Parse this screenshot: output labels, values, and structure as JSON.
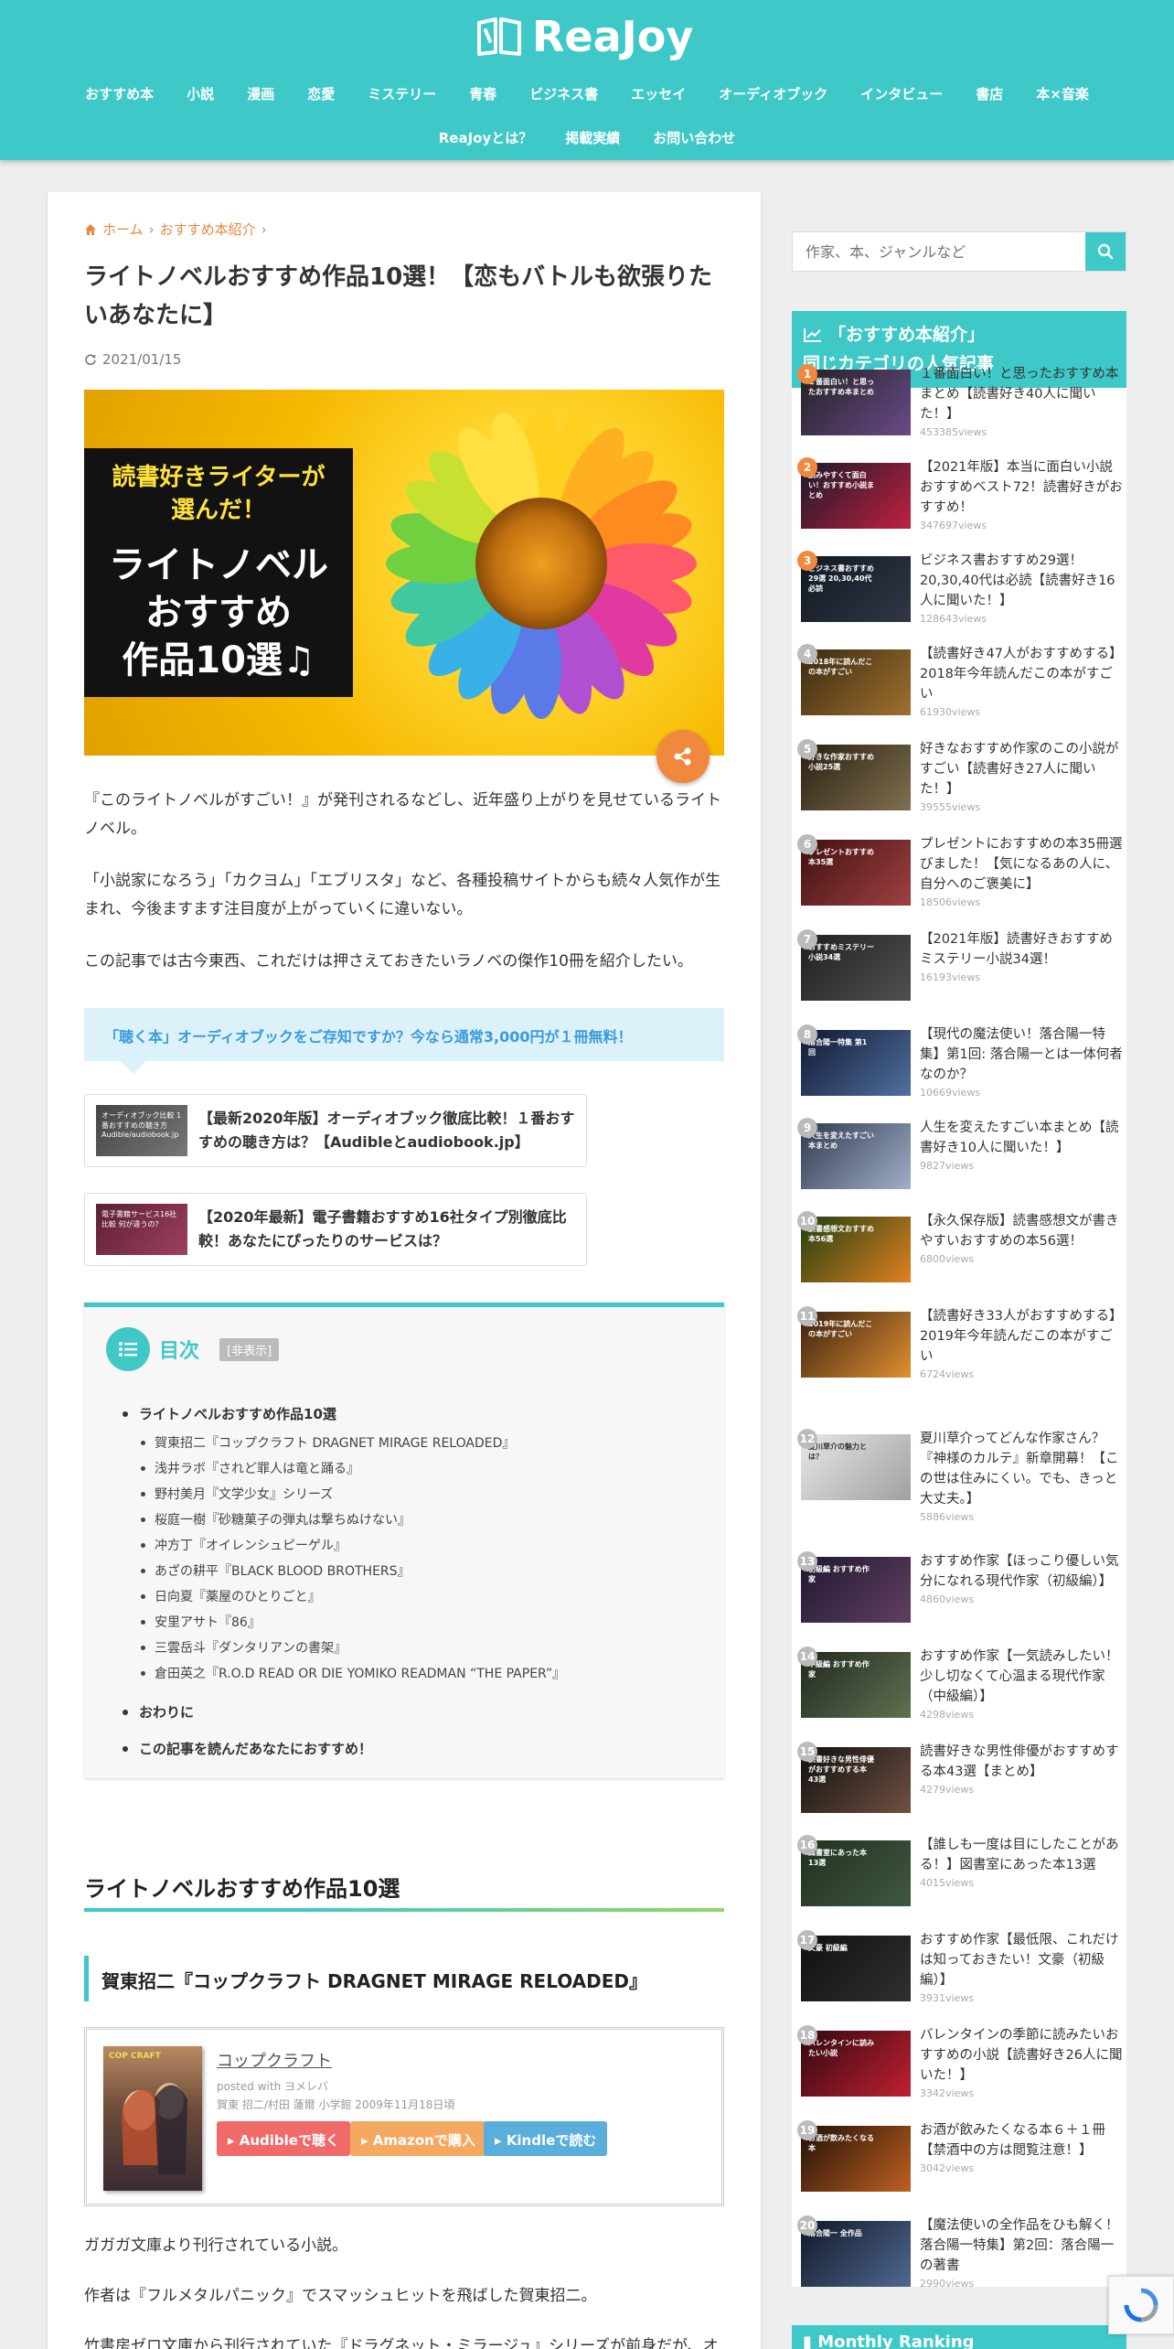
{
  "site": {
    "logo": "ReaJoy"
  },
  "nav": {
    "row1": [
      "おすすめ本",
      "小説",
      "漫画",
      "恋愛",
      "ミステリー",
      "青春",
      "ビジネス書",
      "エッセイ",
      "オーディオブック",
      "インタビュー",
      "書店",
      "本×音楽"
    ],
    "row2": [
      "ReaJoyとは？",
      "掲載実績",
      "お問い合わせ"
    ]
  },
  "breadcrumb": {
    "home": "ホーム",
    "category": "おすすめ本紹介"
  },
  "article": {
    "title": "ライトノベルおすすめ作品10選！【恋もバトルも欲張りたいあなたに】",
    "date": "2021/01/15",
    "hero_sub": "読書好きライターが\n選んだ！",
    "hero_main": "ライトノベル\nおすすめ\n作品10選♫",
    "p1": "『このライトノベルがすごい！』が発刊されるなどし、近年盛り上がりを見せているライトノベル。",
    "p2": "「小説家になろう」「カクヨム」「エブリスタ」など、各種投稿サイトからも続々人気作が生まれ、今後ますます注目度が上がっていくに違いない。",
    "p3": "この記事では古今東西、これだけは押さえておきたいラノベの傑作10冊を紹介したい。",
    "info": "「聴く本」オーディオブックをご存知ですか？今なら通常3,000円が１冊無料！",
    "link1": "【最新2020年版】オーディオブック徹底比較！１番おすすめの聴き方は？【Audibleとaudiobook.jp】",
    "link1_thumb": "オーディオブック比較 1番おすすめの聴き方 Audible/audiobook.jp",
    "link2": "【2020年最新】電子書籍おすすめ16社タイプ別徹底比較！あなたにぴったりのサービスは？",
    "link2_thumb": "電子書籍サービス16社比較 何が違うの？",
    "toc": {
      "title": "目次",
      "toggle": "[非表示]",
      "h2_1": "ライトノベルおすすめ作品10選",
      "items": [
        "賀東招二『コップクラフト DRAGNET MIRAGE RELOADED』",
        "浅井ラボ『されど罪人は竜と踊る』",
        "野村美月『文学少女』シリーズ",
        "桜庭一樹『砂糖菓子の弾丸は撃ちぬけない』",
        "冲方丁『オイレンシュピーゲル』",
        "あざの耕平『BLACK BLOOD BROTHERS』",
        "日向夏『薬屋のひとりごと』",
        "安里アサト『86』",
        "三雲岳斗『ダンタリアンの書架』",
        "倉田英之『R.O.D READ OR DIE YOMIKO READMAN “THE PAPER”』"
      ],
      "h2_2": "おわりに",
      "h2_3": "この記事を読んだあなたにおすすめ！"
    },
    "h2": "ライトノベルおすすめ作品10選",
    "h3": "賀東招二『コップクラフト DRAGNET MIRAGE RELOADED』",
    "book": {
      "title": "コップクラフト",
      "posted": "posted with ヨメレバ",
      "meta": "賀東 招二/村田 蓮爾 小学館 2009年11月18日頃",
      "cover_text": "COP CRAFT",
      "btn1": "Audibleで聴く",
      "btn2": "Amazonで購入",
      "btn3": "Kindleで読む"
    },
    "p4": "ガガガ文庫より刊行されている小説。",
    "p5": "作者は『フルメタルパニック』でスマッシュヒットを飛ばした賀東招二。",
    "p6": "竹書房ゼロ文庫から刊行されていた『ドラグネット・ミラージュ』シリーズが前身だが、オ"
  },
  "sidebar": {
    "search_placeholder": "作家、本、ジャンルなど",
    "rank_title1": "「おすすめ本紹介」",
    "rank_title2": "同じカテゴリの人気記事",
    "items": [
      {
        "num": "1",
        "title": "１番面白い！と思ったおすすめ本まとめ【読書好き40人に聞いた！】",
        "views": "453385views",
        "thumb": "１番面白い！と思ったおすすめ本まとめ"
      },
      {
        "num": "2",
        "title": "【2021年版】本当に面白い小説おすすめベスト72！読書好きがおすすめ！",
        "views": "347697views",
        "thumb": "読みやすくて面白い！おすすめ小説まとめ"
      },
      {
        "num": "3",
        "title": "ビジネス書おすすめ29選！20,30,40代は必読【読書好き16人に聞いた！】",
        "views": "128643views",
        "thumb": "ビジネス書おすすめ29選 20,30,40代必読"
      },
      {
        "num": "4",
        "title": "【読書好き47人がおすすめする】2018年今年読んだこの本がすごい",
        "views": "61930views",
        "thumb": "2018年に読んだこの本がすごい"
      },
      {
        "num": "5",
        "title": "好きなおすすめ作家のこの小説がすごい【読書好き27人に聞いた！】",
        "views": "39555views",
        "thumb": "好きな作家おすすめ小説25選"
      },
      {
        "num": "6",
        "title": "プレゼントにおすすめの本35冊選びました！【気になるあの人に、自分へのご褒美に】",
        "views": "18506views",
        "thumb": "プレゼントおすすめ本35選"
      },
      {
        "num": "7",
        "title": "【2021年版】読書好きおすすめミステリー小説34選！",
        "views": "16193views",
        "thumb": "おすすめミステリー小説34選"
      },
      {
        "num": "8",
        "title": "【現代の魔法使い！落合陽一特集】第1回: 落合陽一とは一体何者なのか？",
        "views": "10669views",
        "thumb": "落合陽一特集 第1回"
      },
      {
        "num": "9",
        "title": "人生を変えたすごい本まとめ【読書好き10人に聞いた！】",
        "views": "9827views",
        "thumb": "人生を変えたすごい本まとめ"
      },
      {
        "num": "10",
        "title": "【永久保存版】読書感想文が書きやすいおすすめの本56選！",
        "views": "6800views",
        "thumb": "読書感想文おすすめ本56選"
      },
      {
        "num": "11",
        "title": "【読書好き33人がおすすめする】2019年今年読んだこの本がすごい",
        "views": "6724views",
        "thumb": "2019年に読んだこの本がすごい"
      },
      {
        "num": "12",
        "title": "夏川草介ってどんな作家さん？『神様のカルテ』新章開幕！【この世は住みにくい。でも、きっと大丈夫。】",
        "views": "5886views",
        "thumb": "夏川草介の魅力とは？"
      },
      {
        "num": "13",
        "title": "おすすめ作家【ほっこり優しい気分になれる現代作家（初級編）】",
        "views": "4860views",
        "thumb": "初級編 おすすめ作家"
      },
      {
        "num": "14",
        "title": "おすすめ作家【一気読みしたい！少し切なくて心温まる現代作家（中級編）】",
        "views": "4298views",
        "thumb": "中級編 おすすめ作家"
      },
      {
        "num": "15",
        "title": "読書好きな男性俳優がおすすめする本43選【まとめ】",
        "views": "4279views",
        "thumb": "読書好きな男性俳優がおすすめする本43選"
      },
      {
        "num": "16",
        "title": "【誰しも一度は目にしたことがある！】図書室にあった本13選",
        "views": "4015views",
        "thumb": "図書室にあった本13選"
      },
      {
        "num": "17",
        "title": "おすすめ作家【最低限、これだけは知っておきたい！文豪（初級編）】",
        "views": "3931views",
        "thumb": "文豪 初級編"
      },
      {
        "num": "18",
        "title": "バレンタインの季節に読みたいおすすめの小説【読書好き26人に聞いた！】",
        "views": "3342views",
        "thumb": "バレンタインに読みたい小説"
      },
      {
        "num": "19",
        "title": "お酒が飲みたくなる本６＋１冊【禁酒中の方は閲覧注意！】",
        "views": "3042views",
        "thumb": "お酒が飲みたくなる本"
      },
      {
        "num": "20",
        "title": "【魔法使いの全作品をひも解く！落合陽一特集】第2回：落合陽一の著書",
        "views": "2990views",
        "thumb": "落合陽一 全作品"
      }
    ],
    "monthly": "Monthly Ranking"
  },
  "colors": {
    "accent": "#3ec8c8",
    "orange": "#f0883e",
    "link": "#e8883a"
  }
}
